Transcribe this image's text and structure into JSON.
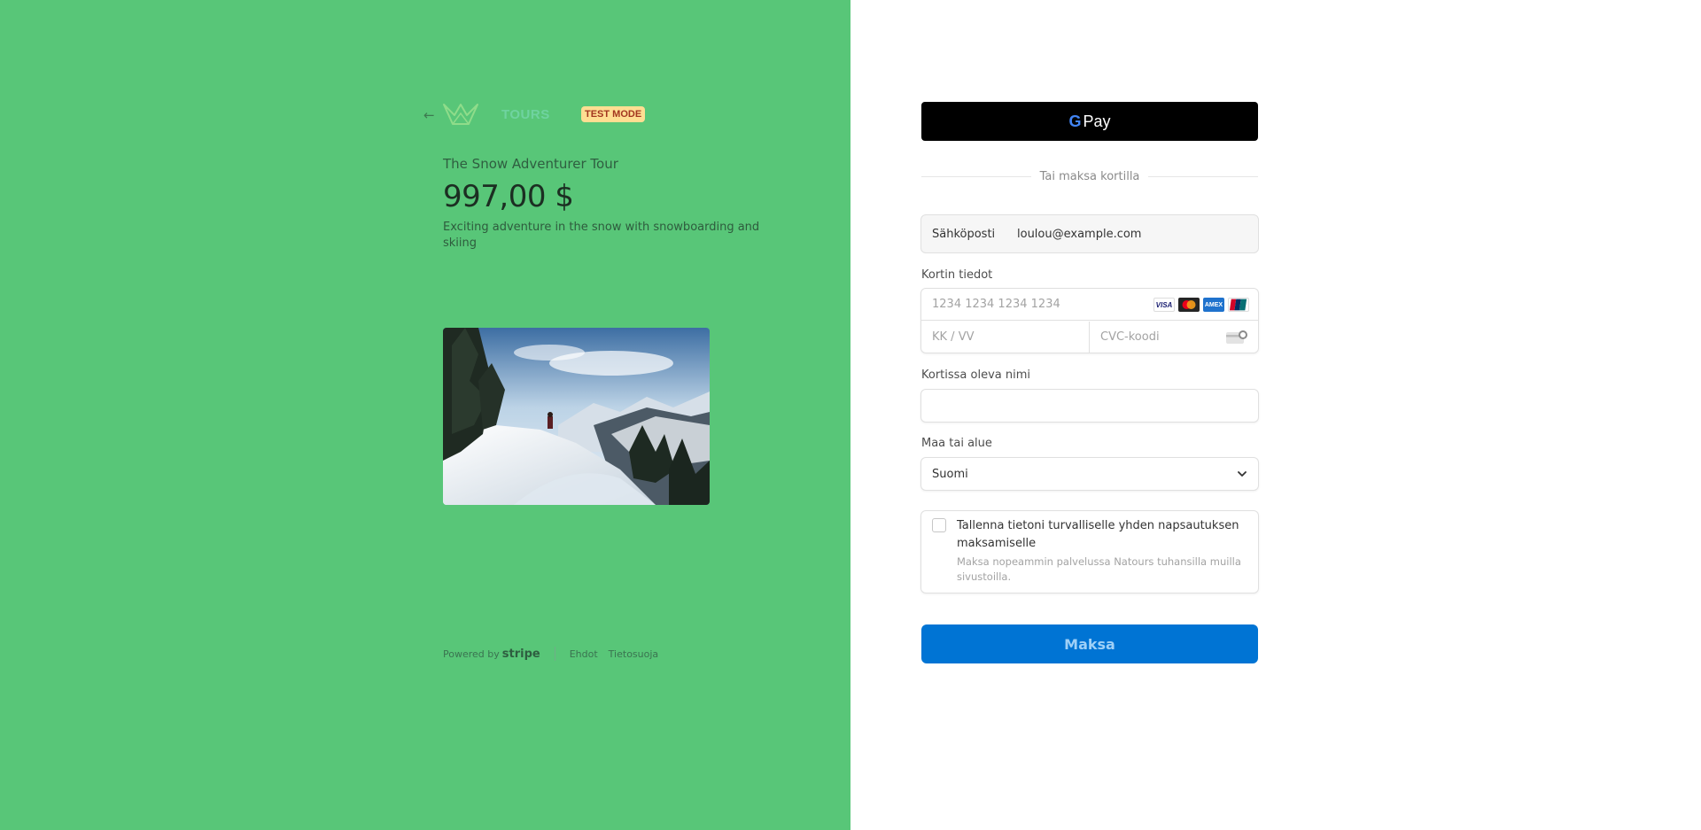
{
  "left": {
    "badge": "TEST MODE",
    "logo_text": "TOURS",
    "product_name": "The Snow Adventurer Tour",
    "price": "997,00 $",
    "description": "Exciting adventure in the snow with snowboarding and skiing",
    "footer": {
      "powered_by": "Powered by",
      "stripe": "stripe",
      "terms": "Ehdot",
      "privacy": "Tietosuoja"
    }
  },
  "right": {
    "gpay": {
      "g": "G",
      "pay": "Pay"
    },
    "divider_text": "Tai maksa kortilla",
    "email": {
      "label": "Sähköposti",
      "value": "loulou@example.com"
    },
    "card": {
      "label": "Kortin tiedot",
      "number_placeholder": "1234 1234 1234 1234",
      "expiry_placeholder": "KK / VV",
      "cvc_placeholder": "CVC-koodi",
      "brands": {
        "visa": "VISA",
        "amex": "AMEX"
      }
    },
    "name": {
      "label": "Kortissa oleva nimi",
      "value": ""
    },
    "country": {
      "label": "Maa tai alue",
      "value": "Suomi"
    },
    "save": {
      "title": "Tallenna tietoni turvalliselle yhden napsautuksen maksamiselle",
      "subtitle": "Maksa nopeammin palvelussa Natours tuhansilla muilla sivustoilla.",
      "checked": false
    },
    "pay_button": "Maksa"
  },
  "colors": {
    "left_bg": "#58c678",
    "pay_button": "#0074d4",
    "badge_bg": "#ffde92",
    "badge_text": "#a2361f"
  },
  "icons": [
    "back-arrow-icon",
    "natours-logo",
    "google-g-icon",
    "visa-icon",
    "mastercard-icon",
    "amex-icon",
    "unionpay-icon",
    "cvc-card-icon",
    "chevron-down-icon"
  ]
}
